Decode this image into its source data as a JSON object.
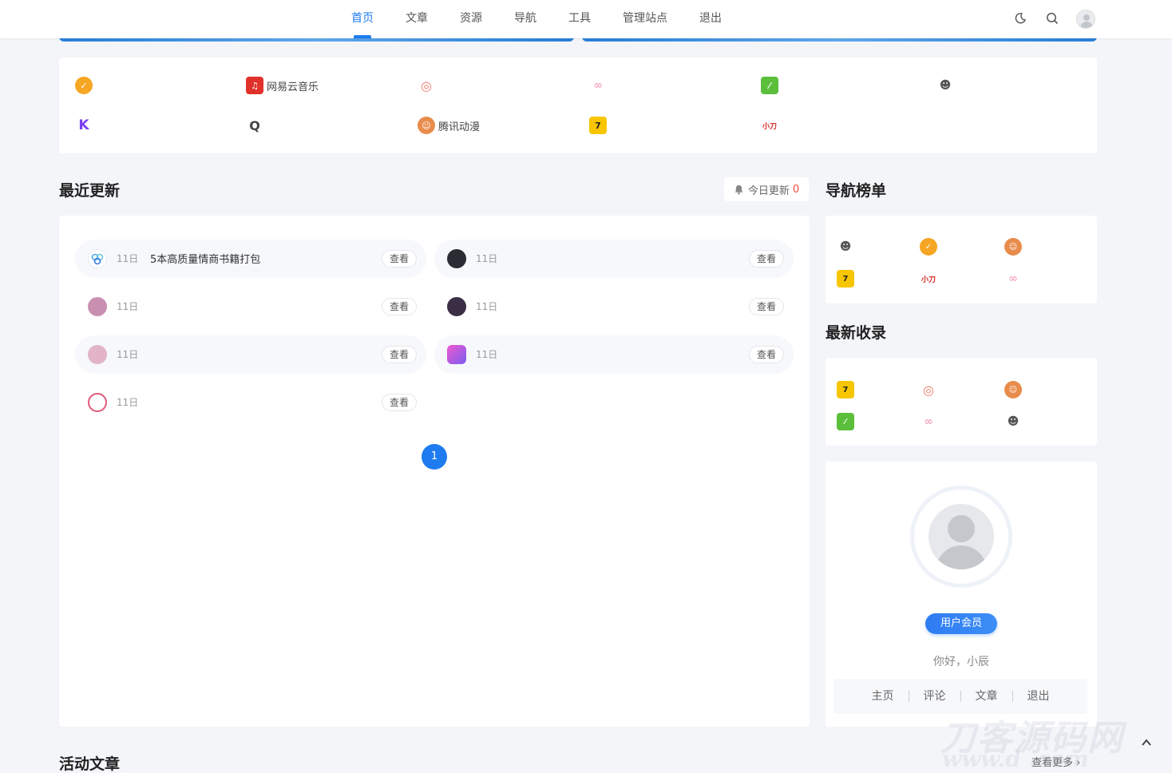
{
  "nav": {
    "items": [
      {
        "label": "首页",
        "active": true
      },
      {
        "label": "文章"
      },
      {
        "label": "资源"
      },
      {
        "label": "导航"
      },
      {
        "label": "工具"
      },
      {
        "label": "管理站点"
      },
      {
        "label": "退出"
      }
    ]
  },
  "header_icons": [
    "moon-icon",
    "search-icon",
    "user-avatar"
  ],
  "links": [
    {
      "label": "",
      "icon": "verified-badge-icon",
      "color": "#f5a623"
    },
    {
      "label": "网易云音乐",
      "icon": "netease-music-icon",
      "color": "#e0322b"
    },
    {
      "label": "",
      "icon": "target-icon",
      "color": "#f07a6a"
    },
    {
      "label": "",
      "icon": "pig-icon",
      "color": "#f4a9c0"
    },
    {
      "label": "",
      "icon": "green-leaf-icon",
      "color": "#5bbf3c"
    },
    {
      "label": "",
      "icon": "cartoon-character-icon",
      "color": "#555555"
    },
    {
      "label": "",
      "icon": "k-logo-icon",
      "color": "#7a3ff0"
    },
    {
      "label": "",
      "icon": "q-logo-icon",
      "color": "#444444"
    },
    {
      "label": "腾讯动漫",
      "icon": "tencent-comic-icon",
      "color": "#e88c4c"
    },
    {
      "label": "",
      "icon": "number-seven-icon",
      "color": "#f7c600"
    },
    {
      "label": "",
      "icon": "xiaodao-entertainment-icon",
      "color": "#d7261f"
    }
  ],
  "recent": {
    "title": "最近更新",
    "today_label": "今日更新",
    "today_count": "0",
    "view_label": "查看",
    "rows": [
      {
        "day": "11日",
        "title": "5本高质量情商书籍打包",
        "avatar_color": "#4aa7f0"
      },
      {
        "day": "11日",
        "title": "",
        "avatar_color": "#2b2b33"
      },
      {
        "day": "11日",
        "title": "",
        "avatar_color": "#c98fb0"
      },
      {
        "day": "11日",
        "title": "",
        "avatar_color": "#3a2f45"
      },
      {
        "day": "11日",
        "title": "",
        "avatar_color": "#e3b4c8"
      },
      {
        "day": "11日",
        "title": "",
        "avatar_color": "#b45cf0"
      },
      {
        "day": "11日",
        "title": "",
        "avatar_color": "#e05a7a"
      }
    ],
    "page": "1"
  },
  "nav_rank": {
    "title": "导航榜单",
    "icons": [
      {
        "icon": "cartoon-character-icon",
        "color": "#555555"
      },
      {
        "icon": "verified-badge-icon",
        "color": "#f5a623"
      },
      {
        "icon": "tencent-comic-icon",
        "color": "#e88c4c"
      },
      {
        "icon": "number-seven-icon",
        "color": "#f7c600"
      },
      {
        "icon": "xiaodao-entertainment-icon",
        "color": "#d7261f"
      },
      {
        "icon": "pig-icon",
        "color": "#f4a9c0"
      }
    ]
  },
  "latest": {
    "title": "最新收录",
    "icons": [
      {
        "icon": "number-seven-icon",
        "color": "#f7c600"
      },
      {
        "icon": "target-icon",
        "color": "#f07a6a"
      },
      {
        "icon": "tencent-comic-icon",
        "color": "#e88c4c"
      },
      {
        "icon": "green-leaf-icon",
        "color": "#5bbf3c"
      },
      {
        "icon": "pig-icon",
        "color": "#f4a9c0"
      },
      {
        "icon": "cartoon-character-icon",
        "color": "#555555"
      }
    ]
  },
  "profile": {
    "member_label": "用户会员",
    "greeting": "你好，小辰",
    "links": [
      "主页",
      "评论",
      "文章",
      "退出"
    ]
  },
  "activity": {
    "title": "活动文章",
    "more_label": "查看更多"
  },
  "watermark": {
    "text": "刀客源码网",
    "url_text": "www.d  .com"
  }
}
